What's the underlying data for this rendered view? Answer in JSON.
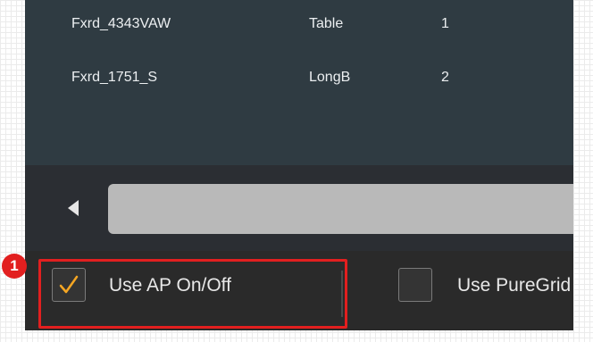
{
  "table": {
    "rows": [
      {
        "name": "Fxrd_4343VAW",
        "type": "Table",
        "count": "1"
      },
      {
        "name": "Fxrd_1751_S",
        "type": "LongBoard",
        "count": "2"
      }
    ]
  },
  "scrollbar": {
    "left_arrow_icon": "triangle-left"
  },
  "options": {
    "use_ap": {
      "label": "Use AP On/Off",
      "checked": true
    },
    "use_puregrid": {
      "label": "Use PureGrid",
      "checked": false
    }
  },
  "annotation": {
    "step": "1"
  },
  "colors": {
    "check_mark": "#f5a623",
    "highlight": "#e21f1f",
    "panel_bg": "#2b2e33",
    "list_bg": "#2f3b42"
  }
}
